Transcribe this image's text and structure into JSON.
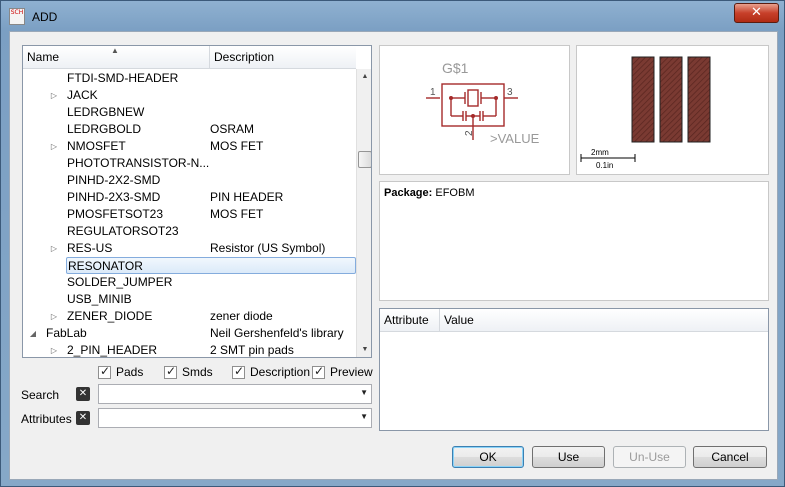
{
  "window": {
    "title": "ADD",
    "close_glyph": "✕",
    "app_icon": "eagle-app-icon"
  },
  "tree": {
    "columns": {
      "name": "Name",
      "description": "Description"
    },
    "rows": [
      {
        "name": "FTDI-SMD-HEADER",
        "description": "",
        "expander": "",
        "indent": 2,
        "selected": false
      },
      {
        "name": "JACK",
        "description": "",
        "expander": "▷",
        "indent": 2,
        "selected": false
      },
      {
        "name": "LEDRGBNEW",
        "description": "",
        "expander": "",
        "indent": 2,
        "selected": false
      },
      {
        "name": "LEDRGBOLD",
        "description": "OSRAM",
        "expander": "",
        "indent": 2,
        "selected": false
      },
      {
        "name": "NMOSFET",
        "description": "MOS FET",
        "expander": "▷",
        "indent": 2,
        "selected": false
      },
      {
        "name": "PHOTOTRANSISTOR-N...",
        "description": "",
        "expander": "",
        "indent": 2,
        "selected": false
      },
      {
        "name": "PINHD-2X2-SMD",
        "description": "",
        "expander": "",
        "indent": 2,
        "selected": false
      },
      {
        "name": "PINHD-2X3-SMD",
        "description": "PIN HEADER",
        "expander": "",
        "indent": 2,
        "selected": false
      },
      {
        "name": "PMOSFETSOT23",
        "description": "MOS FET",
        "expander": "",
        "indent": 2,
        "selected": false
      },
      {
        "name": "REGULATORSOT23",
        "description": "",
        "expander": "",
        "indent": 2,
        "selected": false
      },
      {
        "name": "RES-US",
        "description": "Resistor (US Symbol)",
        "expander": "▷",
        "indent": 2,
        "selected": false
      },
      {
        "name": "RESONATOR",
        "description": "",
        "expander": "",
        "indent": 2,
        "selected": true
      },
      {
        "name": "SOLDER_JUMPER",
        "description": "",
        "expander": "",
        "indent": 2,
        "selected": false
      },
      {
        "name": "USB_MINIB",
        "description": "",
        "expander": "",
        "indent": 2,
        "selected": false
      },
      {
        "name": "ZENER_DIODE",
        "description": "zener diode",
        "expander": "▷",
        "indent": 2,
        "selected": false
      },
      {
        "name": "FabLab",
        "description": "Neil Gershenfeld's library",
        "expander": "◢",
        "indent": 1,
        "selected": false
      },
      {
        "name": "2_PIN_HEADER",
        "description": "2 SMT pin pads",
        "expander": "▷",
        "indent": 2,
        "selected": false
      }
    ]
  },
  "filters": {
    "pads": "Pads",
    "smds": "Smds",
    "description": "Description",
    "preview": "Preview",
    "search_label": "Search",
    "search_value": "",
    "attributes_label": "Attributes",
    "attributes_value": ""
  },
  "symbol": {
    "name": "G$1",
    "pin1": "1",
    "pin2": "2",
    "pin3": "3",
    "value": ">VALUE",
    "color": "#a52a2a"
  },
  "package": {
    "scale_metric": "2mm",
    "scale_imperial": "0.1in",
    "pad_color": "#7a3a32"
  },
  "info": {
    "package_label": "Package:",
    "package_value": "EFOBM"
  },
  "attributes": {
    "col_attribute": "Attribute",
    "col_value": "Value"
  },
  "buttons": {
    "ok": "OK",
    "use": "Use",
    "unuse": "Un-Use",
    "cancel": "Cancel"
  }
}
